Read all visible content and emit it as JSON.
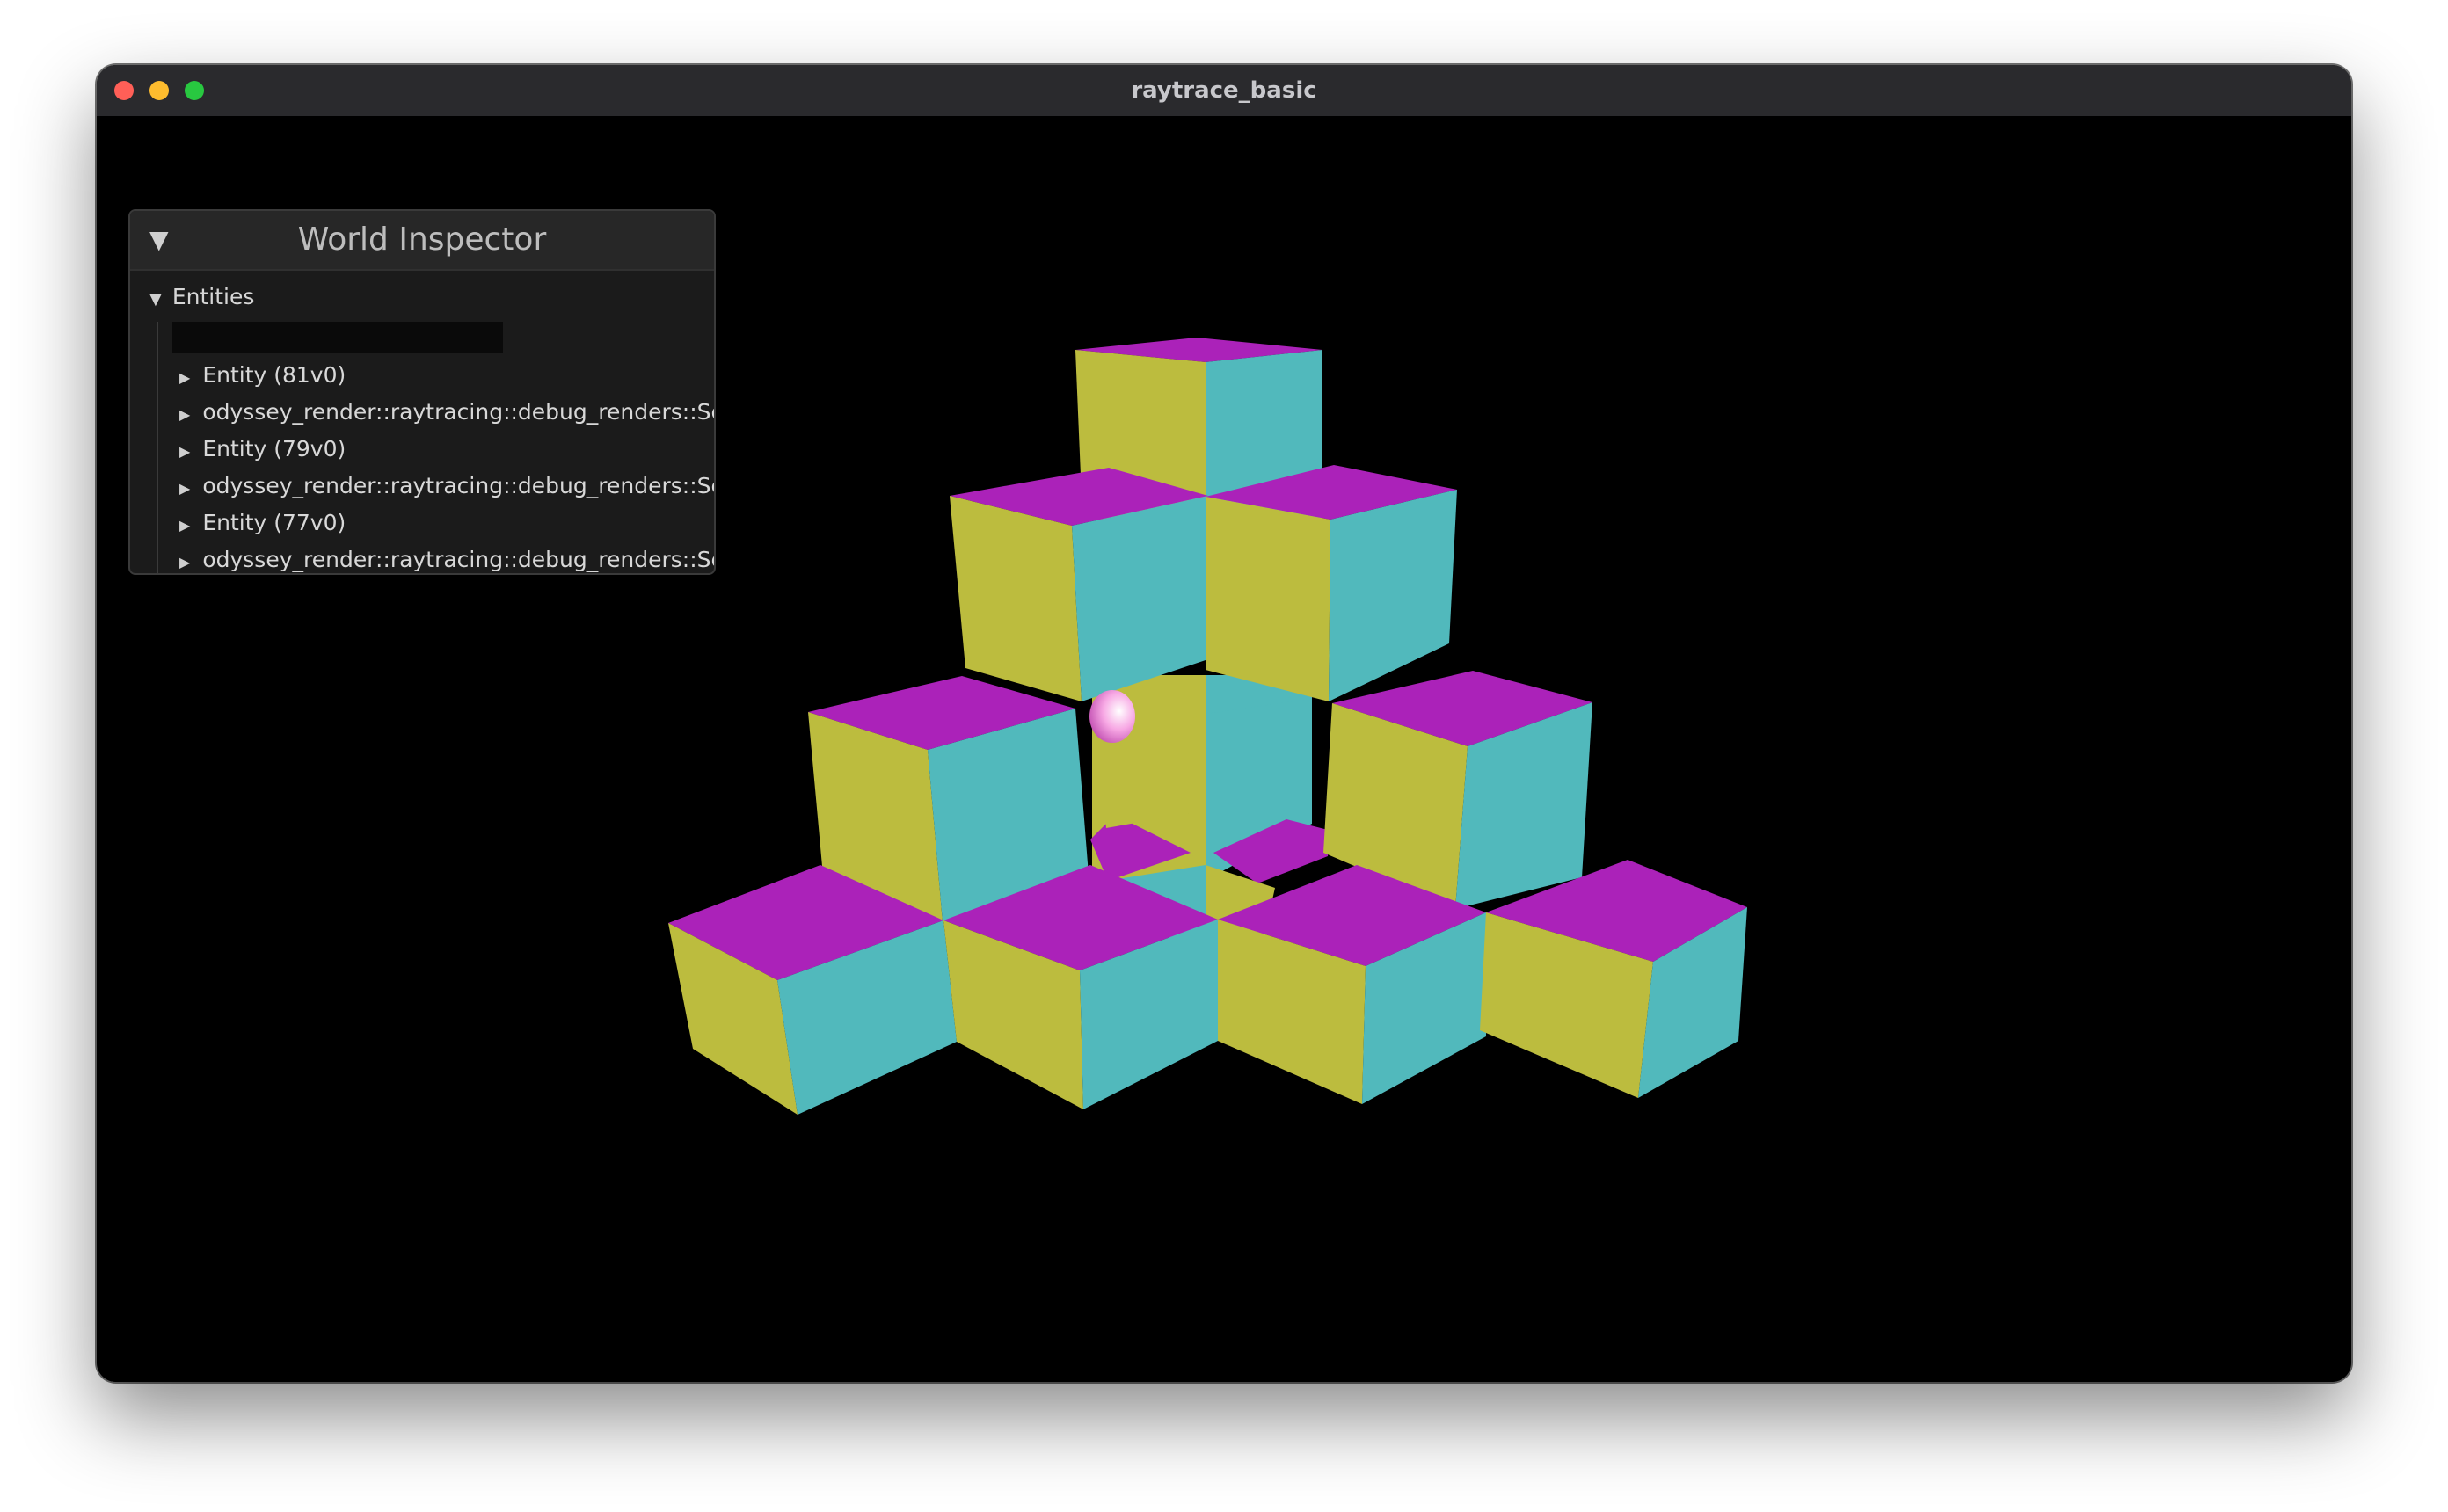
{
  "window": {
    "title": "raytrace_basic"
  },
  "inspector": {
    "collapse_icon": "triangle-down-icon",
    "title": "World Inspector",
    "section_label": "Entities",
    "search_value": "",
    "entities": [
      {
        "label": "Entity (81v0)"
      },
      {
        "label": "odyssey_render::raytracing::debug_renders::Selec"
      },
      {
        "label": "Entity (79v0)"
      },
      {
        "label": "odyssey_render::raytracing::debug_renders::Selec"
      },
      {
        "label": "Entity (77v0)"
      },
      {
        "label": "odyssey_render::raytracing::debug_renders::Selec"
      }
    ]
  },
  "scene": {
    "colors": {
      "top": "#ab22b9",
      "left": "#bcbc3e",
      "right": "#51b9bc",
      "sphere": "#ee7fd5",
      "background": "#000000"
    }
  }
}
